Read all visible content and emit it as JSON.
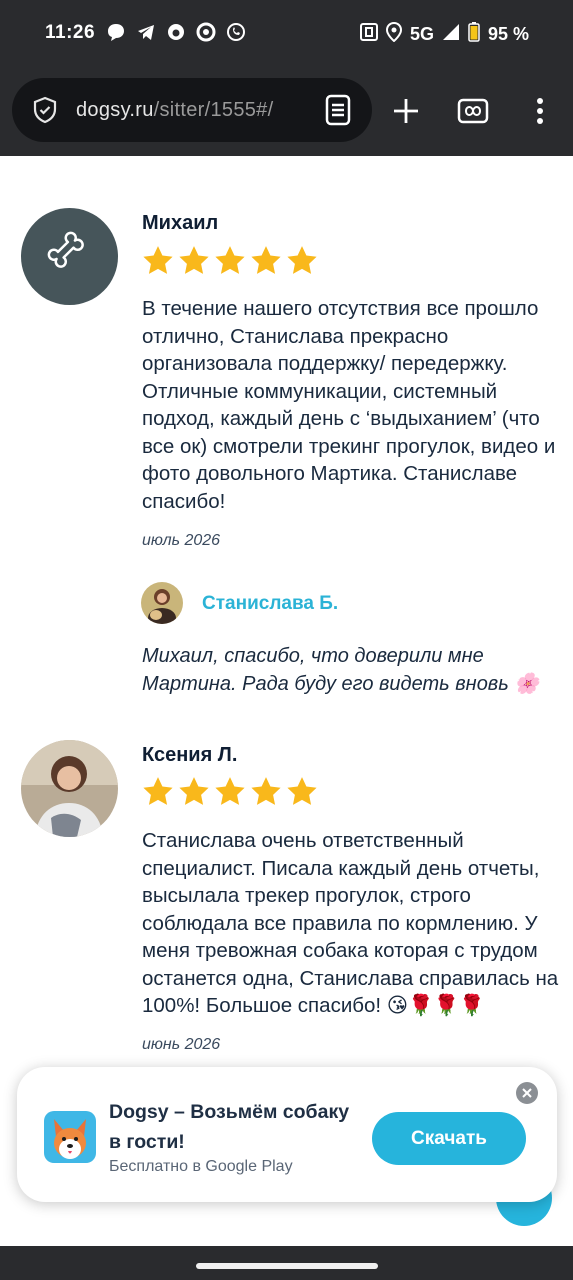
{
  "status_bar": {
    "time": "11:26",
    "network": "5G",
    "battery": "95 %",
    "notification_icons": [
      "chat-bubble-icon",
      "telegram-icon",
      "app-icon",
      "sync-icon",
      "whatsapp-icon"
    ],
    "right_icons": [
      "nfc-icon",
      "location-icon",
      "signal-icon",
      "battery-icon"
    ]
  },
  "browser": {
    "url_host": "dogsy.ru",
    "url_path": "/sitter/1555#/",
    "buttons": [
      "reader-mode-icon",
      "new-tab-icon",
      "private-tabs-icon",
      "more-menu-icon"
    ]
  },
  "reviews": [
    {
      "name": "Михаил",
      "rating": 5,
      "text": "В течение нашего отсутствия все прошло отлично, Станислава прекрасно организовала поддержку/ передержку. Отличные коммуникации, системный подход, каждый день с ‘выдыханием’ (что все ок) смотрели трекинг прогулок, видео и фото довольного Мартика. Станиславе спасибо!",
      "date": "июль 2026",
      "reply": {
        "name": "Станислава Б.",
        "text": "Михаил, спасибо, что доверили мне Мартина. Рада буду его видеть вновь 🌸"
      }
    },
    {
      "name": "Ксения Л.",
      "rating": 5,
      "text": "Станислава очень ответственный специалист. Писала каждый день отчеты, высылала трекер прогулок, строго соблюдала все правила по кормлению. У меня тревожная собака которая с трудом останется одна, Станислава справилась на 100%! Большое спасибо! 😘🌹🌹🌹",
      "date": "июнь 2026"
    }
  ],
  "banner": {
    "title": "Dogsy – Возьмём собаку в гости!",
    "subtitle": "Бесплатно в Google Play",
    "button": "Скачать"
  },
  "colors": {
    "accent": "#26b4dc",
    "star": "#f9b81b",
    "reply_name": "#2bb3d6",
    "text_dark": "#1a2a3e"
  }
}
